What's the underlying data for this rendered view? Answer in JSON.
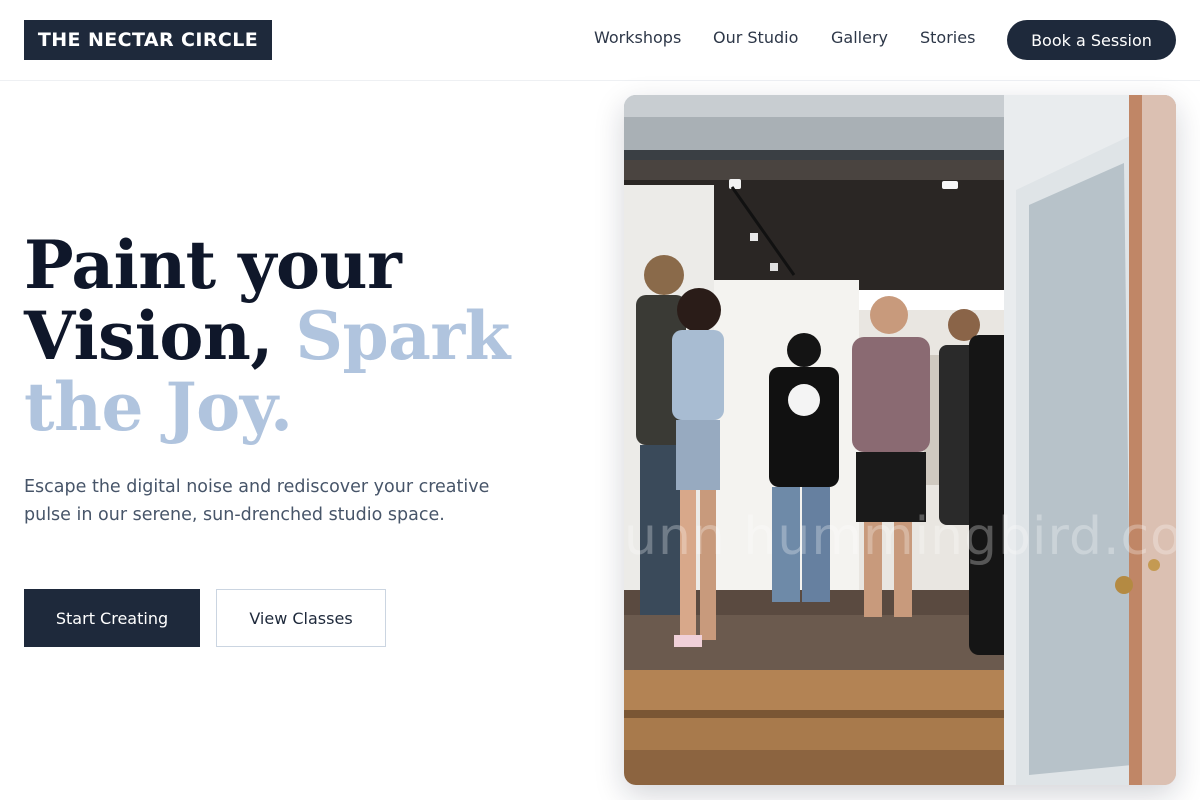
{
  "brand": {
    "name": "THE NECTAR CIRCLE"
  },
  "nav": {
    "items": [
      "Workshops",
      "Our Studio",
      "Gallery",
      "Stories"
    ],
    "cta_label": "Book a Session"
  },
  "hero": {
    "headline_dark": "Paint your Vision,",
    "headline_accent": "Spark the Joy.",
    "subtext": "Escape the digital noise and rediscover your creative pulse in our serene, sun-drenched studio space.",
    "primary_button": "Start Creating",
    "secondary_button": "View Classes"
  },
  "photo": {
    "subject": "people gathered in an open art studio doorway",
    "watermark_text": "unn hummingbird.cor"
  },
  "colors": {
    "primary": "#1e293b",
    "accent": "#b0c4de",
    "heading": "#0f172a",
    "body_text": "#475569"
  }
}
